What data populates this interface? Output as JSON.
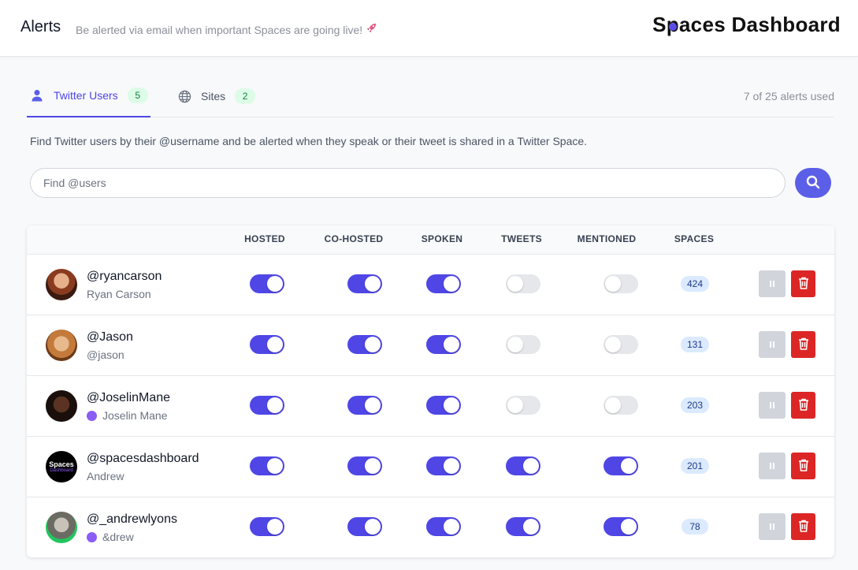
{
  "header": {
    "title": "Alerts",
    "subtitle": "Be alerted via email when important Spaces are going live!",
    "rocket_icon": "rocket-icon",
    "logo_text": "Spaces Dashboard",
    "logo_first": "S",
    "logo_dot_letter": "p",
    "logo_rest": "aces Dashboard",
    "accent_color": "#5b4ee6"
  },
  "tabs": [
    {
      "label": "Twitter Users",
      "count": "5",
      "icon": "user-icon",
      "active": true
    },
    {
      "label": "Sites",
      "count": "2",
      "icon": "globe-icon",
      "active": false
    }
  ],
  "usage": "7 of 25 alerts used",
  "help_text": "Find Twitter users by their @username and be alerted when they speak or their tweet is shared in a Twitter Space.",
  "search": {
    "placeholder": "Find @users",
    "value": "",
    "button_icon": "search-icon"
  },
  "table": {
    "columns": [
      "HOSTED",
      "CO-HOSTED",
      "SPOKEN",
      "TWEETS",
      "MENTIONED",
      "SPACES"
    ],
    "rows": [
      {
        "username": "@ryancarson",
        "display_name": "Ryan Carson",
        "badge": false,
        "hosted": true,
        "cohosted": true,
        "spoken": true,
        "tweets": false,
        "mentioned": false,
        "spaces": "424"
      },
      {
        "username": "@Jason",
        "display_name": "@jason",
        "badge": false,
        "hosted": true,
        "cohosted": true,
        "spoken": true,
        "tweets": false,
        "mentioned": false,
        "spaces": "131"
      },
      {
        "username": "@JoselinMane",
        "display_name": "Joselin Mane",
        "badge": true,
        "hosted": true,
        "cohosted": true,
        "spoken": true,
        "tweets": false,
        "mentioned": false,
        "spaces": "203"
      },
      {
        "username": "@spacesdashboard",
        "display_name": "Andrew",
        "badge": false,
        "avatar_text": "Spaces",
        "avatar_subtext": "Dashboard",
        "hosted": true,
        "cohosted": true,
        "spoken": true,
        "tweets": true,
        "mentioned": true,
        "spaces": "201"
      },
      {
        "username": "@_andrewlyons",
        "display_name": "&drew",
        "badge": true,
        "hosted": true,
        "cohosted": true,
        "spoken": true,
        "tweets": true,
        "mentioned": true,
        "spaces": "78"
      }
    ]
  },
  "colors": {
    "primary": "#4f46e5",
    "danger": "#dc2626",
    "muted": "#d1d5db",
    "success_bg": "#dcfce7"
  }
}
